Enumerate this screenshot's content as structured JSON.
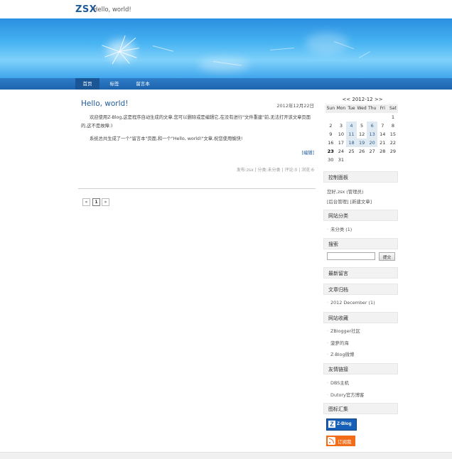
{
  "header": {
    "title": "ZSX",
    "subtitle": "Hello, world!"
  },
  "nav": {
    "items": [
      {
        "label": "首页"
      },
      {
        "label": "标签"
      },
      {
        "label": "留言本"
      }
    ]
  },
  "post": {
    "title": "Hello, world!",
    "date": "2012年12月22日",
    "paragraphs": [
      "欢迎使用Z-Blog,这是程序自动生成的文章.您可以删除或是编辑它,在没有进行\"文件重建\"前,无法打开该文章页面的,这不是故障:)",
      "系统总共生成了一个\"留言本\"页面,和一个\"Hello, world!\"文章,祝您使用愉快!"
    ],
    "edit_label": "[编辑]",
    "meta": {
      "author": "发布:zsx",
      "category": "分类:未分类",
      "comments": "评论:0",
      "views": "浏览:6",
      "sep": "|"
    }
  },
  "pager": {
    "prev": "«",
    "current": "1",
    "next": "»"
  },
  "calendar": {
    "prev": "<<",
    "title": "2012-12",
    "next": ">>",
    "weekdays": [
      "Sun",
      "Mon",
      "Tue",
      "Wed",
      "Thu",
      "Fri",
      "Sat"
    ],
    "weeks": [
      [
        "",
        "",
        "",
        "",
        "",
        "",
        "1"
      ],
      [
        "2",
        "3",
        "4",
        "5",
        "6",
        "7",
        "8"
      ],
      [
        "9",
        "10",
        "11",
        "12",
        "13",
        "14",
        "15"
      ],
      [
        "16",
        "17",
        "18",
        "19",
        "20",
        "21",
        "22"
      ],
      [
        "23",
        "24",
        "25",
        "26",
        "27",
        "28",
        "29"
      ],
      [
        "30",
        "31",
        "",
        "",
        "",
        "",
        ""
      ]
    ],
    "linked_days": [
      "4",
      "6",
      "11",
      "13",
      "18",
      "19",
      "20"
    ],
    "today": "23"
  },
  "sidebar": {
    "control_panel": {
      "title": "控制面板",
      "greeting": "您好,zsx (管理员)",
      "admin_link": "[后台管理]",
      "new_post_link": "[新建文章]"
    },
    "categories": {
      "title": "网站分类",
      "items": [
        "未分类 (1)"
      ]
    },
    "search": {
      "title": "搜索",
      "placeholder": "",
      "button": "提交"
    },
    "latest_comments": {
      "title": "最新留言"
    },
    "archives": {
      "title": "文章归档",
      "items": [
        "2012 December (1)"
      ]
    },
    "favorites": {
      "title": "网站收藏",
      "items": [
        "ZBlogger社区",
        "菠萝的海",
        "Z-Blog微博"
      ]
    },
    "links": {
      "title": "友情链接",
      "items": [
        "DBS主机",
        "Dutory官方博客"
      ]
    },
    "badges": {
      "title": "图标汇集",
      "zblog": "Z-Blog",
      "rss": "订阅我"
    }
  },
  "colors": {
    "accent": "#1f5b9b",
    "nav": "#1e63ad",
    "banner": "#46b3f2",
    "rss": "#f26d1a"
  }
}
